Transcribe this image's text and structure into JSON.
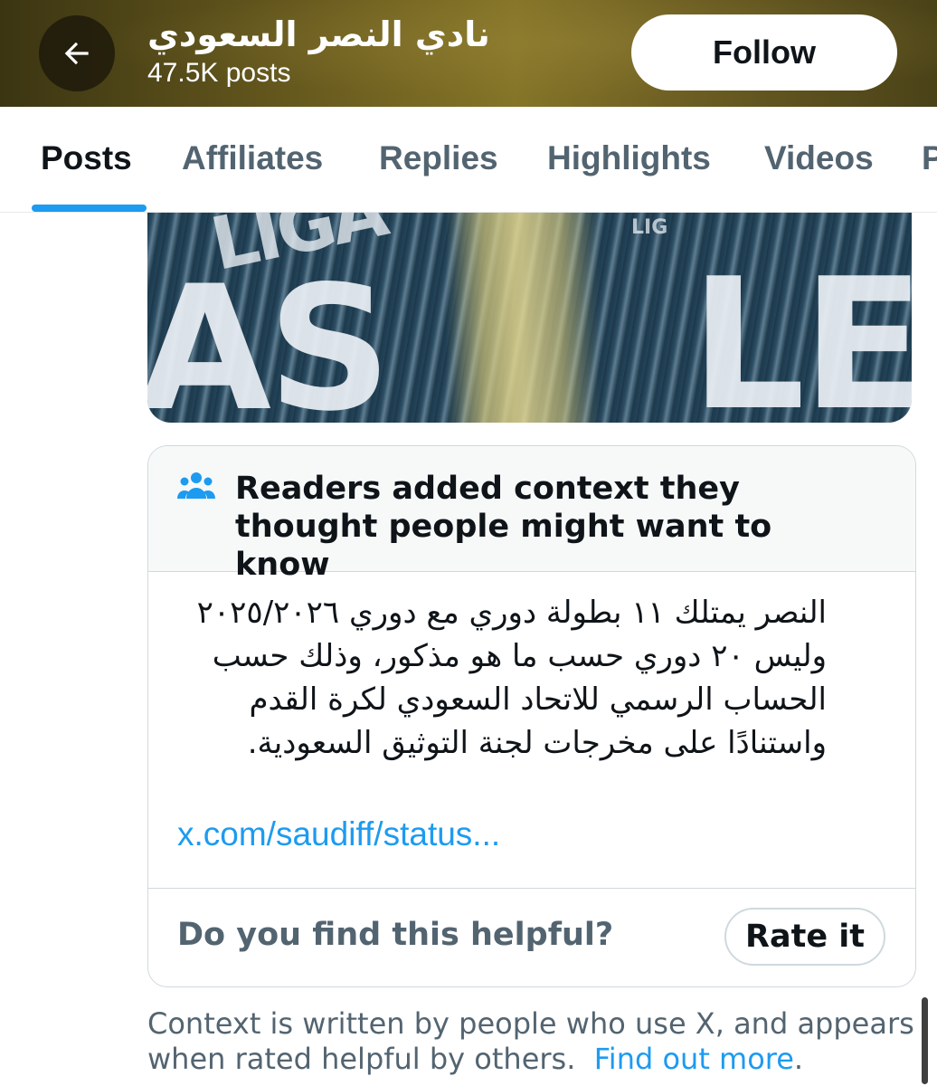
{
  "header": {
    "account_name": "نادي النصر السعودي",
    "post_count": "47.5K posts",
    "follow_label": "Follow"
  },
  "tabs": [
    {
      "label": "Posts",
      "active": true
    },
    {
      "label": "Affiliates",
      "active": false
    },
    {
      "label": "Replies",
      "active": false
    },
    {
      "label": "Highlights",
      "active": false
    },
    {
      "label": "Videos",
      "active": false
    },
    {
      "label": "P",
      "active": false
    }
  ],
  "media": {
    "text_left": "AS",
    "text_top_left": "LIGA",
    "text_small": "LIG",
    "text_right": "LE"
  },
  "note": {
    "title": "Readers added context they thought people might want to know",
    "body_lines": [
      "النصر يمتلك ١١ بطولة دوري مع دوري ٢٠٢٥/٢٠٢٦",
      "وليس ٢٠ دوري حسب ما هو مذكور، وذلك حسب",
      "الحساب الرسمي للاتحاد السعودي لكرة القدم",
      "واستنادًا على مخرجات لجنة التوثيق السعودية."
    ],
    "link": "x.com/saudiff/status...",
    "helpful_question": "Do you find this helpful?",
    "rate_label": "Rate it"
  },
  "footer": {
    "text": "Context is written by people who use X, and appears when rated helpful by others.",
    "link": "Find out more",
    "suffix": "."
  },
  "colors": {
    "accent": "#1d9bf0",
    "muted_text": "#536471",
    "primary_text": "#0f1419"
  }
}
